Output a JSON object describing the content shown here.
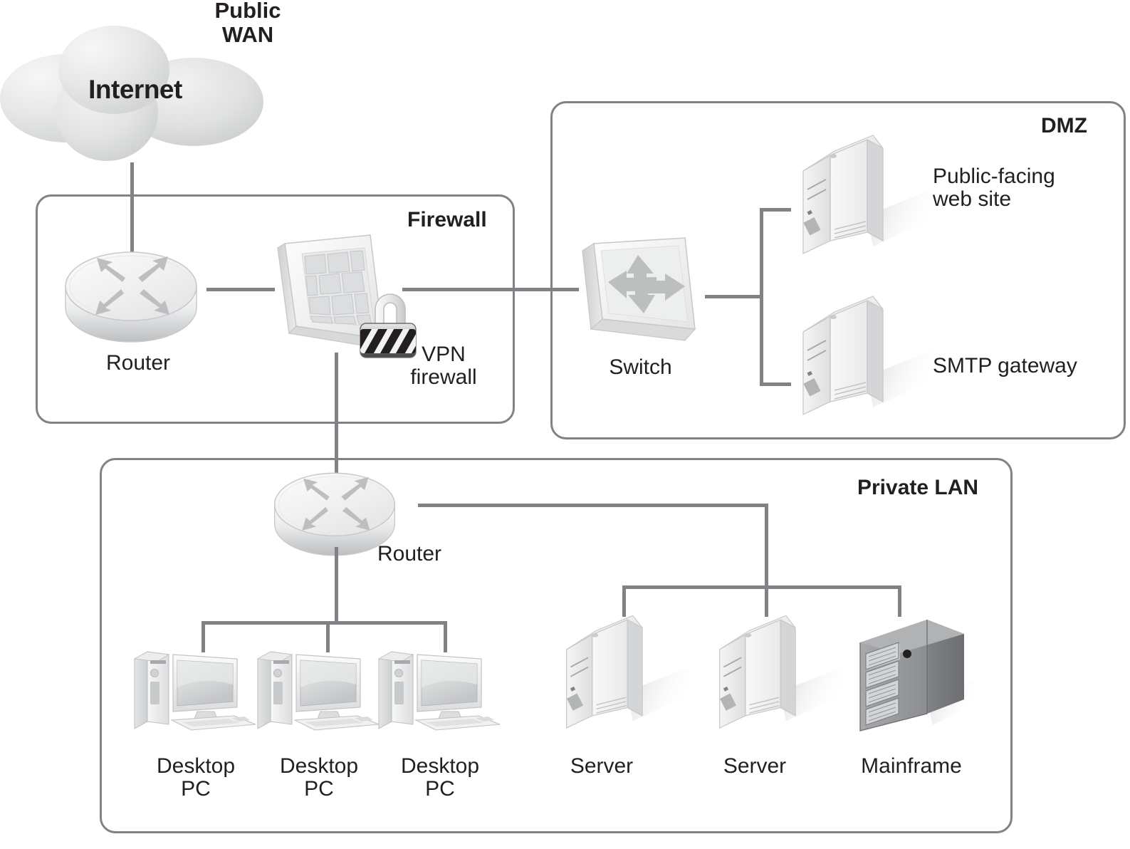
{
  "diagram": {
    "type": "network-topology",
    "title_wan": "Public\nWAN",
    "cloud_label": "Internet",
    "zones": [
      {
        "id": "firewall",
        "title": "Firewall"
      },
      {
        "id": "dmz",
        "title": "DMZ"
      },
      {
        "id": "lan",
        "title": "Private LAN"
      }
    ],
    "nodes": [
      {
        "id": "internet-cloud",
        "label": "Internet",
        "icon": "cloud-icon",
        "zone": "wan"
      },
      {
        "id": "edge-router",
        "label": "Router",
        "icon": "router-icon",
        "zone": "firewall"
      },
      {
        "id": "vpn-firewall",
        "label": "VPN\nfirewall",
        "icon": "firewall-lock-icon",
        "zone": "firewall"
      },
      {
        "id": "dmz-switch",
        "label": "Switch",
        "icon": "switch-icon",
        "zone": "dmz"
      },
      {
        "id": "web-server",
        "label": "Public-facing\nweb site",
        "icon": "server-icon",
        "zone": "dmz"
      },
      {
        "id": "smtp-server",
        "label": "SMTP gateway",
        "icon": "server-icon",
        "zone": "dmz"
      },
      {
        "id": "lan-router",
        "label": "Router",
        "icon": "router-icon",
        "zone": "lan"
      },
      {
        "id": "desktop-pc-1",
        "label": "Desktop\nPC",
        "icon": "desktop-pc-icon",
        "zone": "lan"
      },
      {
        "id": "desktop-pc-2",
        "label": "Desktop\nPC",
        "icon": "desktop-pc-icon",
        "zone": "lan"
      },
      {
        "id": "desktop-pc-3",
        "label": "Desktop\nPC",
        "icon": "desktop-pc-icon",
        "zone": "lan"
      },
      {
        "id": "lan-server-1",
        "label": "Server",
        "icon": "server-icon",
        "zone": "lan"
      },
      {
        "id": "lan-server-2",
        "label": "Server",
        "icon": "server-icon",
        "zone": "lan"
      },
      {
        "id": "mainframe",
        "label": "Mainframe",
        "icon": "mainframe-icon",
        "zone": "lan"
      }
    ],
    "colors": {
      "line": "#808285",
      "text": "#231f20",
      "zone_border": "#808285",
      "icon_light": "#f1f2f2",
      "icon_mid": "#d1d3d4",
      "icon_dark": "#939598",
      "mainframe_body": "#808285",
      "background": "#ffffff"
    }
  }
}
